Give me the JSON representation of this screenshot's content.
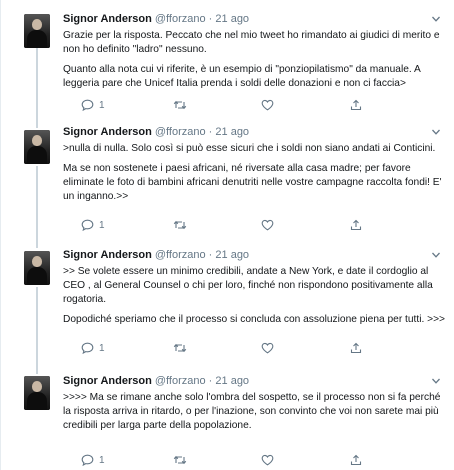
{
  "tweets": [
    {
      "name": "Signor Anderson",
      "handle": "@fforzano",
      "separator": "·",
      "date": "21 ago",
      "paragraphs": [
        "Grazie per la risposta. Peccato che nel mio tweet ho rimandato ai giudici di merito e non ho definito \"ladro\" nessuno.",
        "Quanto alla nota cui vi riferite, è un esempio di \"ponziopilatismo\" da manuale. A leggeria pare che Unicef Italia prenda i soldi delle donazioni e non ci faccia>"
      ],
      "reply_count": "1",
      "icons": [
        "reply-icon",
        "retweet-icon",
        "like-icon",
        "share-icon"
      ]
    },
    {
      "name": "Signor Anderson",
      "handle": "@fforzano",
      "separator": "·",
      "date": "21 ago",
      "paragraphs": [
        ">nulla di nulla. Solo così si può esse sicuri che i soldi non siano andati ai Conticini.",
        "Ma se non sostenete i paesi africani, né riversate alla casa madre; per favore eliminate le foto di bambini africani denutriti nelle vostre campagne raccolta fondi! E' un inganno.>>"
      ],
      "reply_count": "1"
    },
    {
      "name": "Signor Anderson",
      "handle": "@fforzano",
      "separator": "·",
      "date": "21 ago",
      "paragraphs": [
        ">> Se volete essere un minimo credibili, andate a New York, e date il cordoglio al CEO , al General Counsel o chi per loro, finché non rispondono positivamente alla rogatoria.",
        "Dopodiché speriamo che il processo si concluda con assoluzione piena per tutti. >>>"
      ],
      "reply_count": "1"
    },
    {
      "name": "Signor Anderson",
      "handle": "@fforzano",
      "separator": "·",
      "date": "21 ago",
      "paragraphs": [
        ">>>> Ma se rimane anche solo l'ombra del sospetto, se il processo non si fa perché la risposta arriva in ritardo, o per l'inazione, son convinto che voi non sarete mai più credibili per larga parte della popolazione."
      ],
      "reply_count": "1"
    }
  ]
}
